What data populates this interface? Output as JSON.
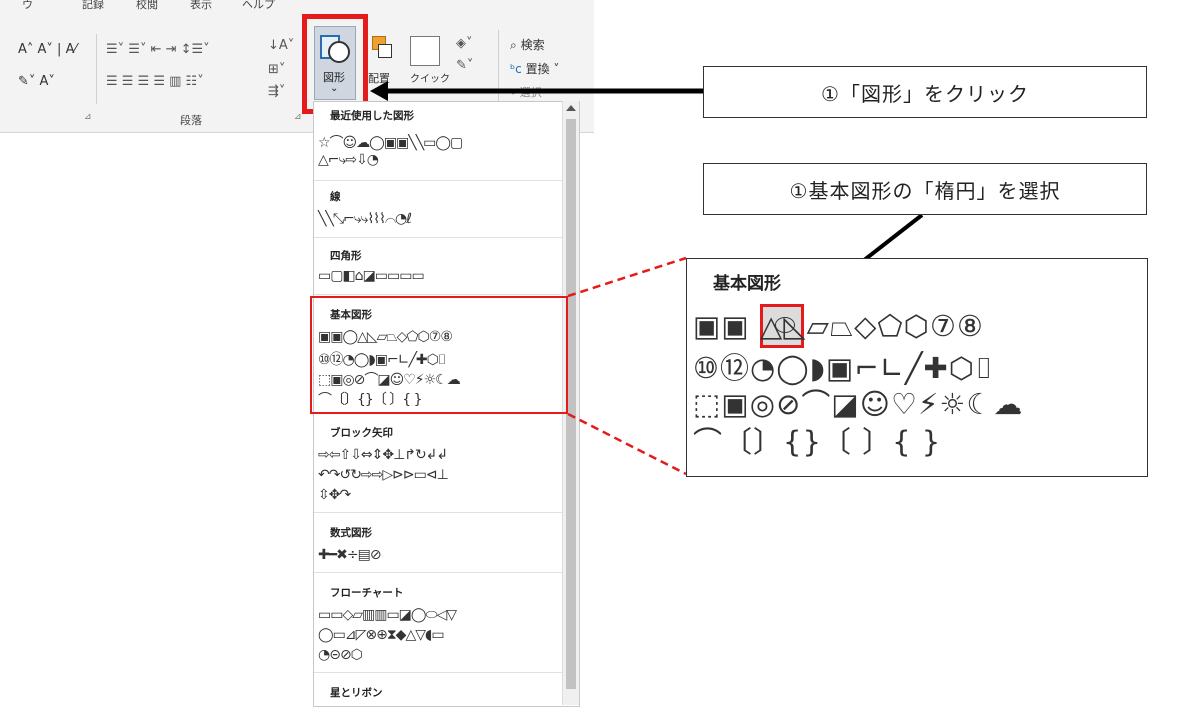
{
  "ribbon": {
    "tabs": [
      "ウ",
      "記録",
      "校閲",
      "表示",
      "ヘルプ"
    ],
    "paragraph_group_label": "段落",
    "shapes_button_label": "図形",
    "arrange_label": "配置",
    "quick_style_label": "クイック",
    "search_label": "検索",
    "replace_label": "置換",
    "select_label": "選択"
  },
  "callouts": {
    "step1": "①「図形」をクリック",
    "step2": "①基本図形の「楕円」を選択"
  },
  "gallery": {
    "sections": [
      {
        "title": "最近使用した図形",
        "rows": [
          "☆⌒☺☁◯▣▣╲╲▭◯▢",
          "△⌐⤷⇨⇩◔"
        ]
      },
      {
        "title": "線",
        "rows": [
          "╲╲⤡⌐⤷⤷⌇⌇⌇⌒◔ℓ"
        ]
      },
      {
        "title": "四角形",
        "rows": [
          "▭▢◧⌂◪▭▭▭▭"
        ]
      },
      {
        "title": "基本図形",
        "rows": [
          "▣▣◯△◺▱⏢◇⬠⬡⑦⑧",
          "⑩⑫◔◯◗▣⌐∟╱✚⬡⌷",
          "⬚▣◎⊘⌒◪☺♡⚡☼☾☁",
          "⌒〔〕{}〔 〕{ }"
        ]
      },
      {
        "title": "ブロック矢印",
        "rows": [
          "⇨⇦⇧⇩⇔⇕✥⊥↱↻↲↲",
          "↶↷↺↻⇨⇨▷⊳⊳▭⊲⊥",
          "⇳✥↷"
        ]
      },
      {
        "title": "数式図形",
        "rows": [
          "✚━✖÷▤⊘"
        ]
      },
      {
        "title": "フローチャート",
        "rows": [
          "▭▭◇▱▥▥▭◪◯⬭◁▽",
          "◯▭⊿◸⊗⊕⧗◆△▽◖▭",
          "◔⊝⊘⬡"
        ]
      },
      {
        "title": "星とリボン",
        "rows": []
      }
    ]
  },
  "zoom": {
    "title": "基本図形",
    "rows": [
      "▣▣ △◺▱⏢◇⬠⬡⑦⑧",
      "⑩⑫◔◯◗▣⌐∟╱✚⬡⌷",
      "⬚▣◎⊘⌒◪☺♡⚡☼☾☁",
      "⌒〔〕{}〔 〕{ }"
    ]
  },
  "colors": {
    "highlight": "#e41b1b",
    "arrow": "#000000",
    "dashed": "#e41b1b"
  }
}
